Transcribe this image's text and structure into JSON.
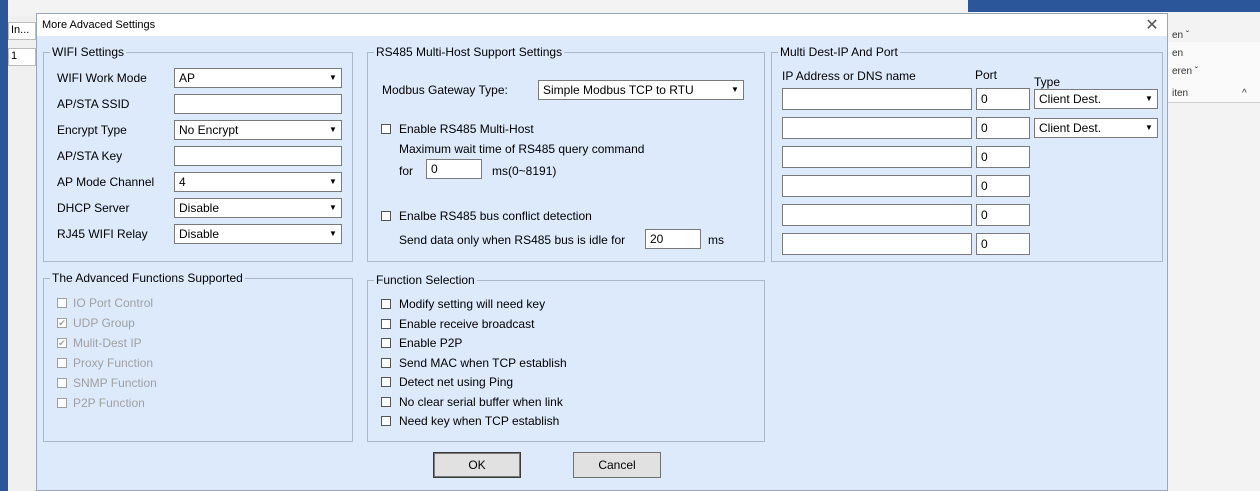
{
  "background": {
    "left_tab_label": "In...",
    "row_number": "1",
    "right_items": [
      "en ˇ",
      "en",
      "eren ˇ",
      "iten",
      "^"
    ]
  },
  "dialog": {
    "title": "More Advaced Settings",
    "close_glyph": "✕"
  },
  "wifi": {
    "legend": "WIFI Settings",
    "work_mode": {
      "label": "WIFI Work Mode",
      "value": "AP"
    },
    "ssid": {
      "label": "AP/STA SSID",
      "value": ""
    },
    "encrypt": {
      "label": "Encrypt Type",
      "value": "No Encrypt"
    },
    "key": {
      "label": "AP/STA Key",
      "value": ""
    },
    "channel": {
      "label": "AP Mode Channel",
      "value": "4"
    },
    "dhcp": {
      "label": "DHCP Server",
      "value": "Disable"
    },
    "relay": {
      "label": "RJ45 WIFI Relay",
      "value": "Disable"
    }
  },
  "advanced": {
    "legend": "The Advanced Functions Supported",
    "items": [
      {
        "label": "IO Port Control",
        "checked": false
      },
      {
        "label": "UDP Group",
        "checked": true
      },
      {
        "label": "Mulit-Dest IP",
        "checked": true
      },
      {
        "label": "Proxy Function",
        "checked": false
      },
      {
        "label": "SNMP Function",
        "checked": false
      },
      {
        "label": "P2P Function",
        "checked": false
      }
    ]
  },
  "rs485": {
    "legend": "RS485 Multi-Host Support Settings",
    "gateway_label": "Modbus Gateway Type:",
    "gateway_value": "Simple Modbus TCP to RTU",
    "multihost_label": "Enable RS485 Multi-Host",
    "max_wait_label": "Maximum wait time of RS485  query command",
    "for_label": "for",
    "wait_value": "0",
    "wait_unit": "ms(0~8191)",
    "conflict_label": "Enalbe RS485 bus conflict detection",
    "idle_label": "Send data only when RS485 bus is idle for",
    "idle_value": "20",
    "idle_unit": "ms"
  },
  "function_selection": {
    "legend": "Function Selection",
    "items": [
      "Modify setting will need key",
      "Enable receive broadcast",
      "Enable P2P",
      "Send MAC when TCP establish",
      "Detect net using Ping",
      "No clear serial buffer when link",
      "Need key when TCP establish"
    ]
  },
  "multi_dest": {
    "legend": "Multi Dest-IP And Port",
    "col_ip": "IP Address or DNS name",
    "col_port": "Port",
    "col_type": "Type",
    "rows": [
      {
        "ip": "",
        "port": "0",
        "type": "Client Dest."
      },
      {
        "ip": "",
        "port": "0",
        "type": "Client Dest."
      },
      {
        "ip": "",
        "port": "0"
      },
      {
        "ip": "",
        "port": "0"
      },
      {
        "ip": "",
        "port": "0"
      },
      {
        "ip": "",
        "port": "0"
      }
    ]
  },
  "buttons": {
    "ok": "OK",
    "cancel": "Cancel"
  },
  "icons": {
    "dropdown_arrow": "▼",
    "check_mark": "✔"
  }
}
